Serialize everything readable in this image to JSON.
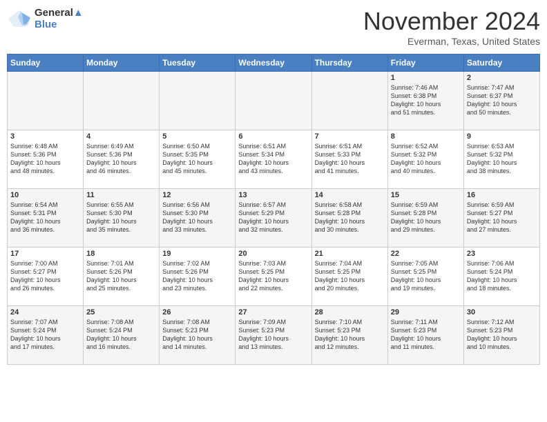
{
  "header": {
    "logo_line1": "General",
    "logo_line2": "Blue",
    "month": "November 2024",
    "location": "Everman, Texas, United States"
  },
  "weekdays": [
    "Sunday",
    "Monday",
    "Tuesday",
    "Wednesday",
    "Thursday",
    "Friday",
    "Saturday"
  ],
  "weeks": [
    [
      {
        "day": "",
        "content": ""
      },
      {
        "day": "",
        "content": ""
      },
      {
        "day": "",
        "content": ""
      },
      {
        "day": "",
        "content": ""
      },
      {
        "day": "",
        "content": ""
      },
      {
        "day": "1",
        "content": "Sunrise: 7:46 AM\nSunset: 6:38 PM\nDaylight: 10 hours\nand 51 minutes."
      },
      {
        "day": "2",
        "content": "Sunrise: 7:47 AM\nSunset: 6:37 PM\nDaylight: 10 hours\nand 50 minutes."
      }
    ],
    [
      {
        "day": "3",
        "content": "Sunrise: 6:48 AM\nSunset: 5:36 PM\nDaylight: 10 hours\nand 48 minutes."
      },
      {
        "day": "4",
        "content": "Sunrise: 6:49 AM\nSunset: 5:36 PM\nDaylight: 10 hours\nand 46 minutes."
      },
      {
        "day": "5",
        "content": "Sunrise: 6:50 AM\nSunset: 5:35 PM\nDaylight: 10 hours\nand 45 minutes."
      },
      {
        "day": "6",
        "content": "Sunrise: 6:51 AM\nSunset: 5:34 PM\nDaylight: 10 hours\nand 43 minutes."
      },
      {
        "day": "7",
        "content": "Sunrise: 6:51 AM\nSunset: 5:33 PM\nDaylight: 10 hours\nand 41 minutes."
      },
      {
        "day": "8",
        "content": "Sunrise: 6:52 AM\nSunset: 5:32 PM\nDaylight: 10 hours\nand 40 minutes."
      },
      {
        "day": "9",
        "content": "Sunrise: 6:53 AM\nSunset: 5:32 PM\nDaylight: 10 hours\nand 38 minutes."
      }
    ],
    [
      {
        "day": "10",
        "content": "Sunrise: 6:54 AM\nSunset: 5:31 PM\nDaylight: 10 hours\nand 36 minutes."
      },
      {
        "day": "11",
        "content": "Sunrise: 6:55 AM\nSunset: 5:30 PM\nDaylight: 10 hours\nand 35 minutes."
      },
      {
        "day": "12",
        "content": "Sunrise: 6:56 AM\nSunset: 5:30 PM\nDaylight: 10 hours\nand 33 minutes."
      },
      {
        "day": "13",
        "content": "Sunrise: 6:57 AM\nSunset: 5:29 PM\nDaylight: 10 hours\nand 32 minutes."
      },
      {
        "day": "14",
        "content": "Sunrise: 6:58 AM\nSunset: 5:28 PM\nDaylight: 10 hours\nand 30 minutes."
      },
      {
        "day": "15",
        "content": "Sunrise: 6:59 AM\nSunset: 5:28 PM\nDaylight: 10 hours\nand 29 minutes."
      },
      {
        "day": "16",
        "content": "Sunrise: 6:59 AM\nSunset: 5:27 PM\nDaylight: 10 hours\nand 27 minutes."
      }
    ],
    [
      {
        "day": "17",
        "content": "Sunrise: 7:00 AM\nSunset: 5:27 PM\nDaylight: 10 hours\nand 26 minutes."
      },
      {
        "day": "18",
        "content": "Sunrise: 7:01 AM\nSunset: 5:26 PM\nDaylight: 10 hours\nand 25 minutes."
      },
      {
        "day": "19",
        "content": "Sunrise: 7:02 AM\nSunset: 5:26 PM\nDaylight: 10 hours\nand 23 minutes."
      },
      {
        "day": "20",
        "content": "Sunrise: 7:03 AM\nSunset: 5:25 PM\nDaylight: 10 hours\nand 22 minutes."
      },
      {
        "day": "21",
        "content": "Sunrise: 7:04 AM\nSunset: 5:25 PM\nDaylight: 10 hours\nand 20 minutes."
      },
      {
        "day": "22",
        "content": "Sunrise: 7:05 AM\nSunset: 5:25 PM\nDaylight: 10 hours\nand 19 minutes."
      },
      {
        "day": "23",
        "content": "Sunrise: 7:06 AM\nSunset: 5:24 PM\nDaylight: 10 hours\nand 18 minutes."
      }
    ],
    [
      {
        "day": "24",
        "content": "Sunrise: 7:07 AM\nSunset: 5:24 PM\nDaylight: 10 hours\nand 17 minutes."
      },
      {
        "day": "25",
        "content": "Sunrise: 7:08 AM\nSunset: 5:24 PM\nDaylight: 10 hours\nand 16 minutes."
      },
      {
        "day": "26",
        "content": "Sunrise: 7:08 AM\nSunset: 5:23 PM\nDaylight: 10 hours\nand 14 minutes."
      },
      {
        "day": "27",
        "content": "Sunrise: 7:09 AM\nSunset: 5:23 PM\nDaylight: 10 hours\nand 13 minutes."
      },
      {
        "day": "28",
        "content": "Sunrise: 7:10 AM\nSunset: 5:23 PM\nDaylight: 10 hours\nand 12 minutes."
      },
      {
        "day": "29",
        "content": "Sunrise: 7:11 AM\nSunset: 5:23 PM\nDaylight: 10 hours\nand 11 minutes."
      },
      {
        "day": "30",
        "content": "Sunrise: 7:12 AM\nSunset: 5:23 PM\nDaylight: 10 hours\nand 10 minutes."
      }
    ]
  ]
}
